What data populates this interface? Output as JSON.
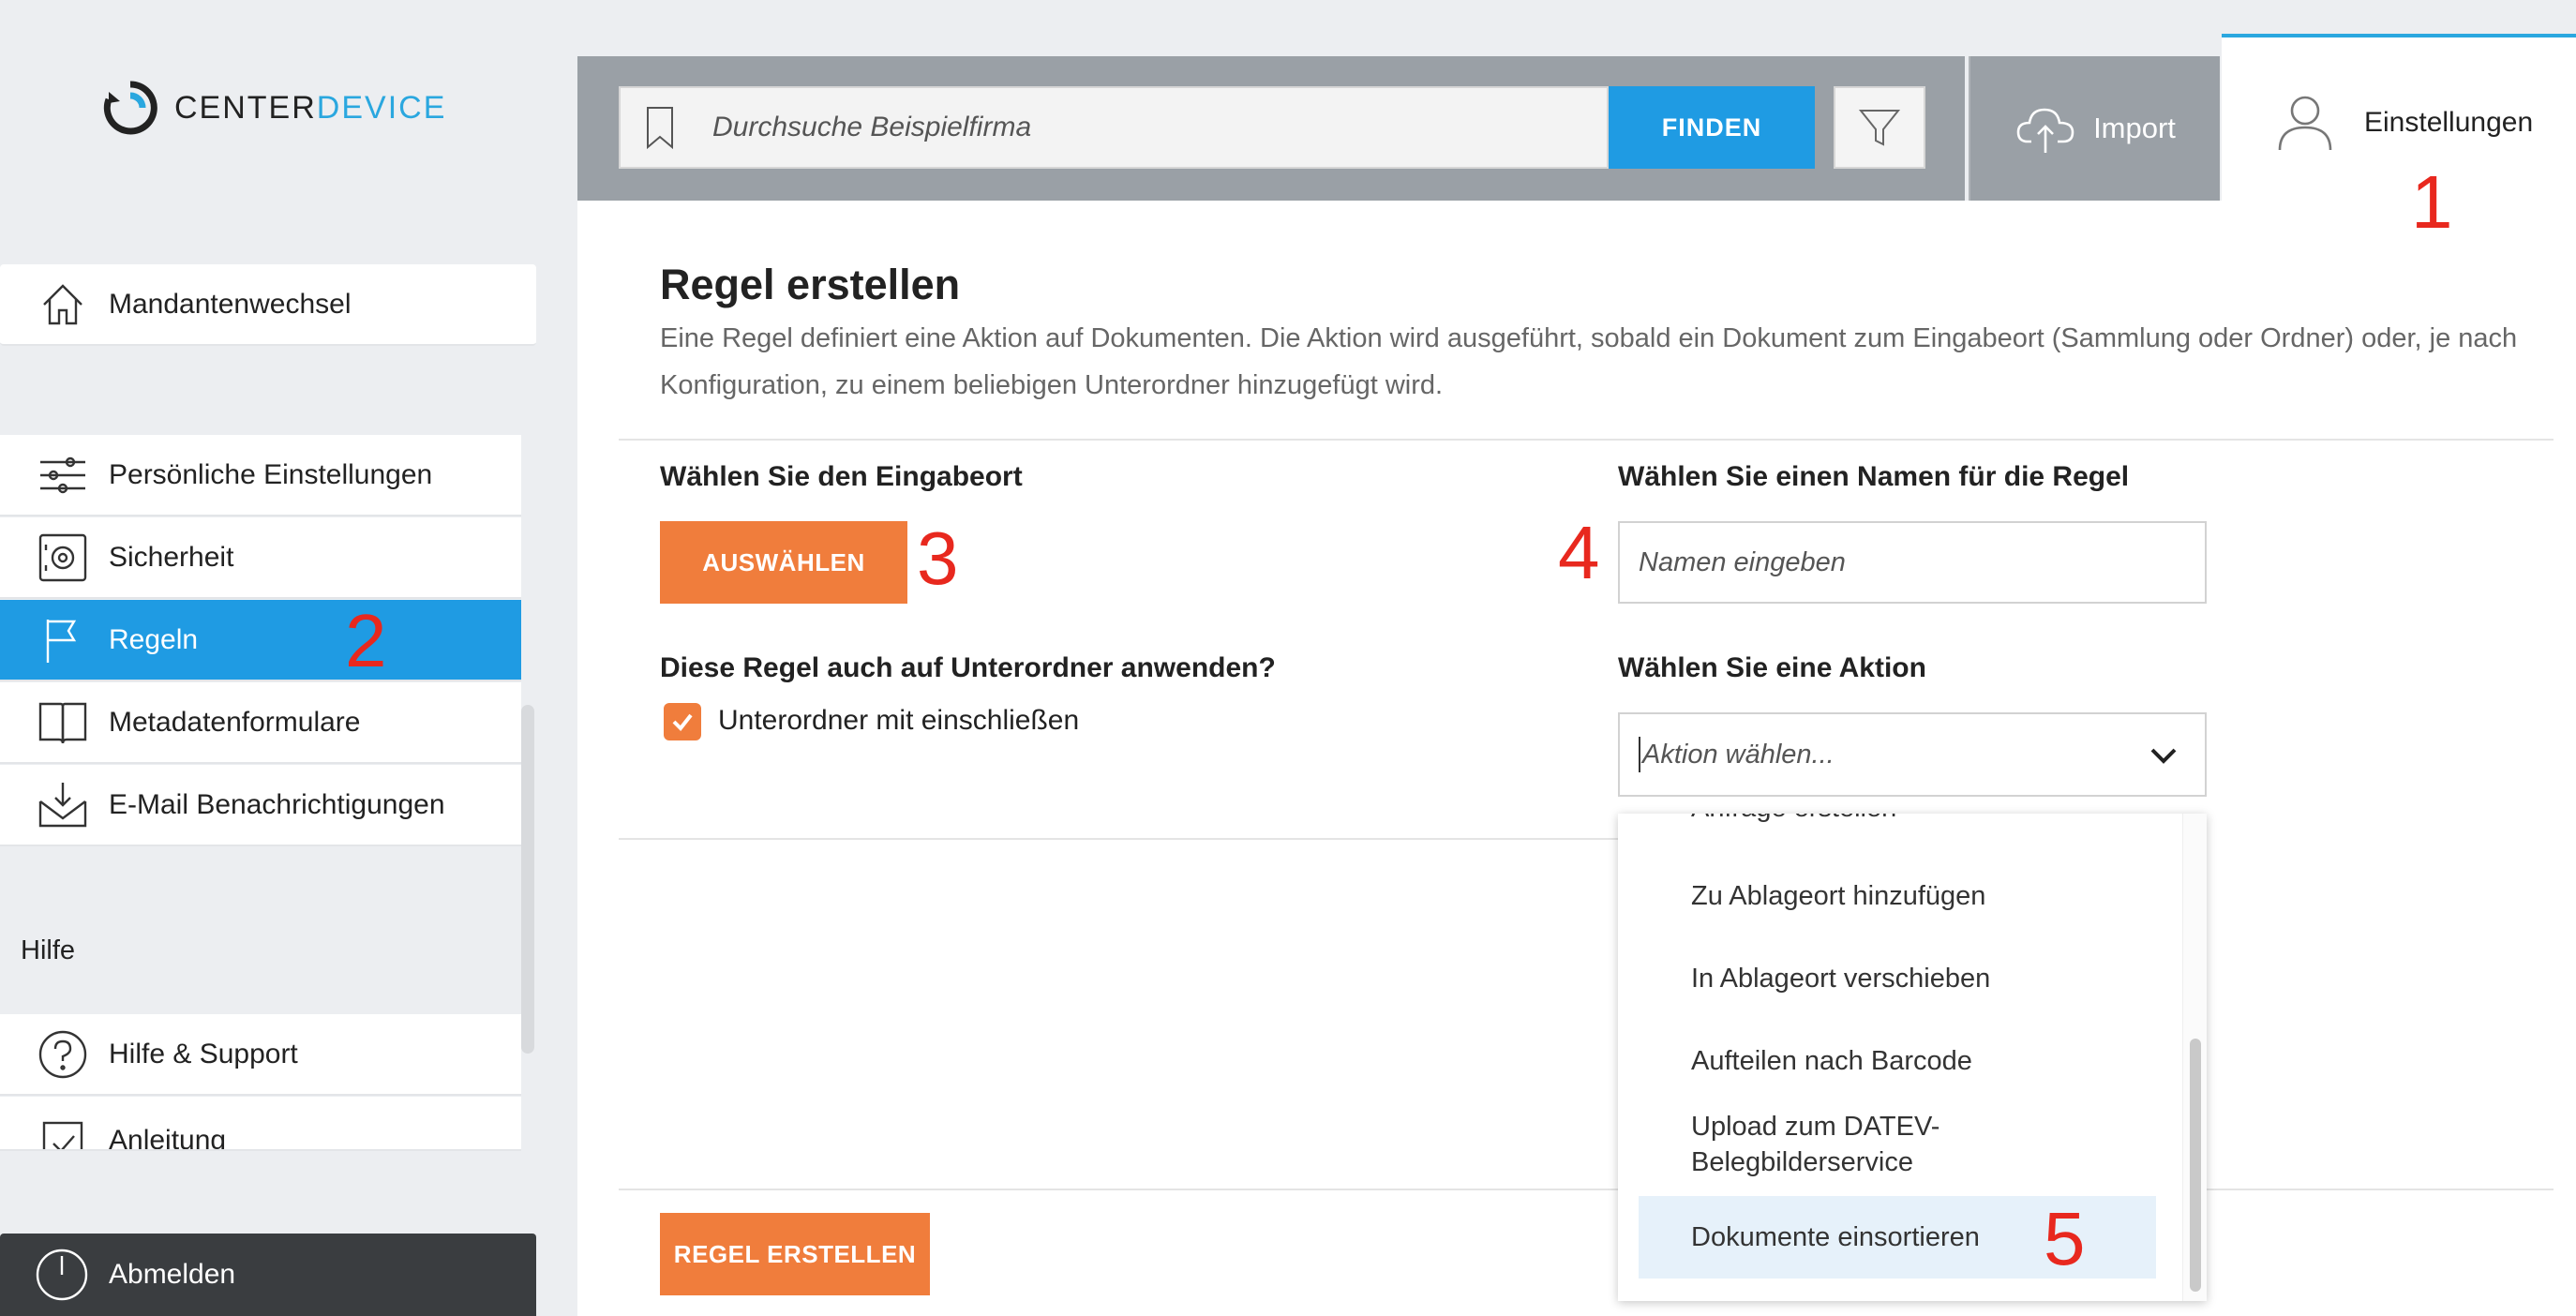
{
  "brand": {
    "logo_text_a": "CENTER",
    "logo_text_b": "DEVICE"
  },
  "sidebar": {
    "items": [
      {
        "label": "Mandantenwechsel",
        "icon": "home-icon"
      },
      {
        "label": "Persönliche Einstellungen",
        "icon": "sliders-icon"
      },
      {
        "label": "Sicherheit",
        "icon": "safe-icon"
      },
      {
        "label": "Regeln",
        "icon": "flag-icon",
        "active": true
      },
      {
        "label": "Metadatenformulare",
        "icon": "book-icon"
      },
      {
        "label": "E-Mail Benachrichtigungen",
        "icon": "mail-inbox-icon"
      }
    ],
    "help_title": "Hilfe",
    "help_items": [
      {
        "label": "Hilfe & Support",
        "icon": "question-icon"
      },
      {
        "label": "Anleitung",
        "icon": "checklist-icon"
      }
    ],
    "logout_label": "Abmelden"
  },
  "topbar": {
    "search_placeholder": "Durchsuche Beispielfirma",
    "search_button": "FINDEN",
    "import_label": "Import",
    "settings_label": "Einstellungen"
  },
  "main": {
    "title": "Regel erstellen",
    "description": "Eine Regel definiert eine Aktion auf Dokumenten. Die Aktion wird ausgeführt, sobald ein Dokument zum Eingabeort (Sammlung oder Ordner) oder, je nach Konfiguration, zu einem beliebigen Unterordner hinzugefügt wird.",
    "input_location_label": "Wählen Sie den Eingabeort",
    "select_button": "AUSWÄHLEN",
    "subfolder_question": "Diese Regel auch auf Unterordner anwenden?",
    "subfolder_checkbox": "Unterordner mit einschließen",
    "subfolder_checked": true,
    "name_label": "Wählen Sie einen Namen für die Regel",
    "name_placeholder": "Namen eingeben",
    "action_label": "Wählen Sie eine Aktion",
    "action_placeholder": "Aktion wählen...",
    "action_options": [
      "Anfrage erstellen",
      "Zu Ablageort hinzufügen",
      "In Ablageort verschieben",
      "Aufteilen nach Barcode",
      "Upload zum DATEV-\nBelegbilderservice",
      "Dokumente einsortieren"
    ],
    "highlighted_option": "Dokumente einsortieren",
    "create_button": "REGEL ERSTELLEN"
  },
  "annotations": [
    "1",
    "2",
    "3",
    "4",
    "5"
  ],
  "colors": {
    "accent_blue": "#1f9be3",
    "accent_orange": "#f07d3c",
    "annotation_red": "#e8281e"
  }
}
